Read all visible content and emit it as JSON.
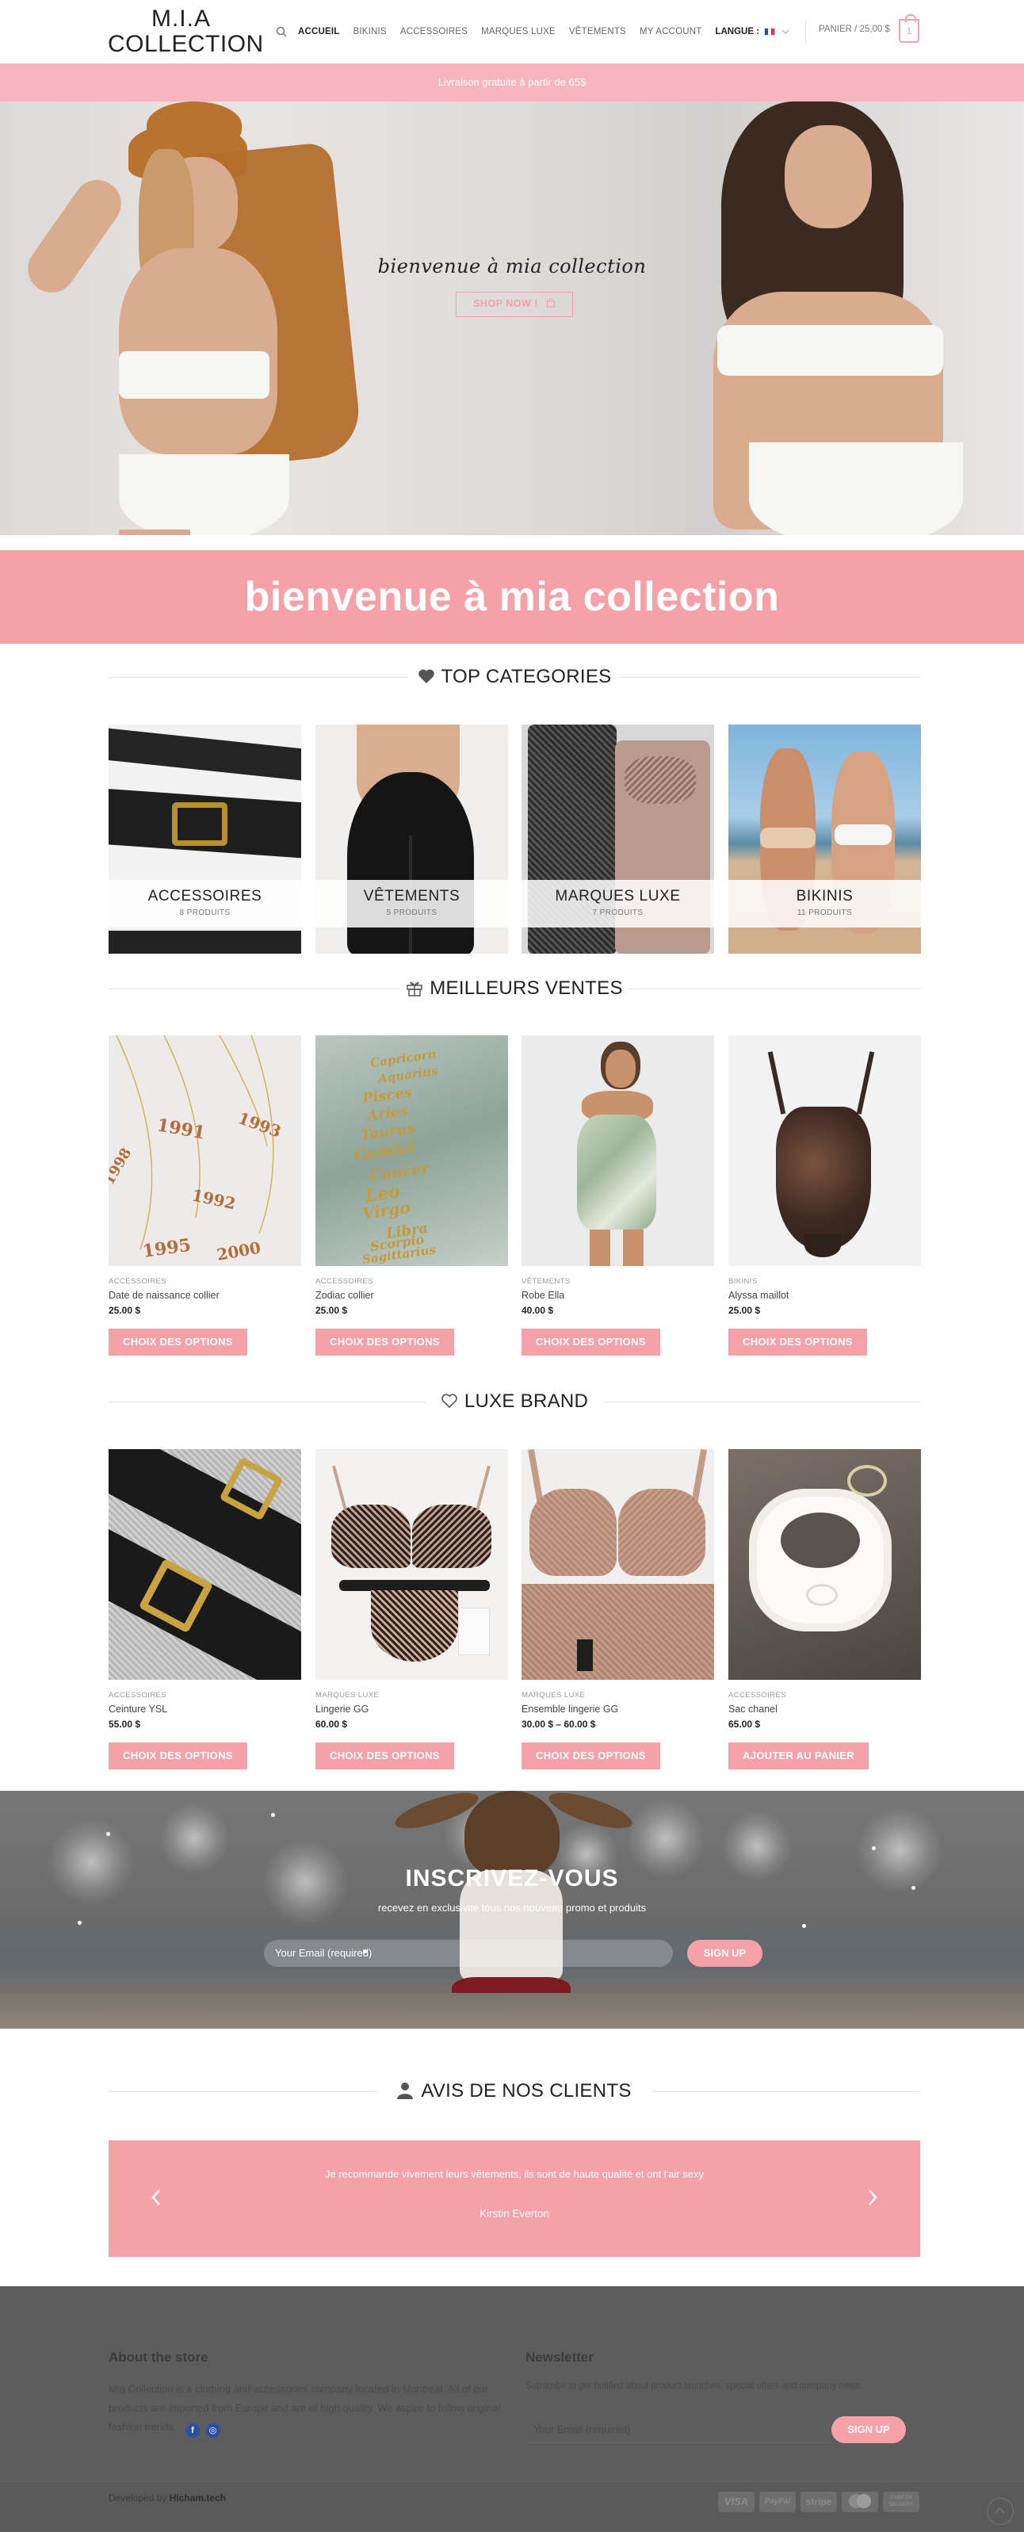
{
  "header": {
    "logo_line1": "M.I.A",
    "logo_line2": "COLLECTION",
    "nav": [
      "ACCUEIL",
      "BIKINIS",
      "ACCESSOIRES",
      "MARQUES LUXE",
      "VÊTEMENTS",
      "MY ACCOUNT"
    ],
    "language": "LANGUE :",
    "cart_label": "PANIER / 25,00 $",
    "cart_count": "1"
  },
  "shipping_bar": "Livraison gratuite à partir de 65$",
  "hero": {
    "title": "bienvenue à mia collection",
    "button": "SHOP NOW !"
  },
  "welcome_banner": "bienvenue à mia collection",
  "sections": {
    "categories_title": "TOP CATEGORIES",
    "best_title": "MEILLEURS VENTES",
    "luxe_title": "LUXE BRAND",
    "reviews_title": "AVIS DE NOS CLIENTS"
  },
  "categories": [
    {
      "name": "ACCESSOIRES",
      "count": "8 PRODUITS"
    },
    {
      "name": "VÊTEMENTS",
      "count": "5 PRODUITS"
    },
    {
      "name": "MARQUES LUXE",
      "count": "7 PRODUITS"
    },
    {
      "name": "BIKINIS",
      "count": "11 PRODUITS"
    }
  ],
  "best_sellers": [
    {
      "category": "ACCESSOIRES",
      "name": "Date de naissance collier",
      "price": "25.00 $",
      "button": "CHOIX DES OPTIONS"
    },
    {
      "category": "ACCESSOIRES",
      "name": "Zodiac collier",
      "price": "25.00 $",
      "button": "CHOIX DES OPTIONS"
    },
    {
      "category": "VÊTEMENTS",
      "name": "Robe Ella",
      "price": "40.00 $",
      "button": "CHOIX DES OPTIONS"
    },
    {
      "category": "BIKINIS",
      "name": "Alyssa maillot",
      "price": "25.00 $",
      "button": "CHOIX DES OPTIONS"
    }
  ],
  "luxe_products": [
    {
      "category": "ACCESSOIRES",
      "name": "Ceinture YSL",
      "price": "55.00 $",
      "button": "CHOIX DES OPTIONS"
    },
    {
      "category": "MARQUES LUXE",
      "name": "Lingerie GG",
      "price": "60.00 $",
      "button": "CHOIX DES OPTIONS"
    },
    {
      "category": "MARQUES LUXE",
      "name": "Ensemble lingerie GG",
      "price": "30.00 $ – 60.00 $",
      "button": "CHOIX DES OPTIONS"
    },
    {
      "category": "ACCESSOIRES",
      "name": "Sac chanel",
      "price": "65.00 $",
      "button": "AJOUTER AU PANIER"
    }
  ],
  "necklace_words": [
    "1991",
    "1993",
    "1992",
    "1995",
    "2000",
    "1998"
  ],
  "zodiac_words": [
    "Capricorn",
    "Aquarius",
    "Pisces",
    "Aries",
    "Taurus",
    "Gemini",
    "Cancer",
    "Leo",
    "Virgo",
    "Libra",
    "Scorpio",
    "Sagittarius"
  ],
  "newsletter": {
    "title": "INSCRIVEZ-VOUS",
    "subtitle": "recevez en exclusivité tous nos nouveau promo et produits",
    "email_placeholder": "Your Email (required)",
    "button": "SIGN UP"
  },
  "review": {
    "quote": "Je recommande vivement leurs vêtements, ils sont de haute qualité et ont l'air sexy",
    "author": "Kirstin Everton"
  },
  "footer": {
    "about_title": "About the store",
    "about_text": "Mia Collection is a clothing and accessories company located in Montreal. All of our products are imported from Europe and are of high quality. We aspire to follow original fashion trends.",
    "newsletter_title": "Newsletter",
    "newsletter_text": "Subscribe to get notified about product launches, special offers and company news.",
    "newsletter_placeholder": "Your Email (required)",
    "newsletter_button": "SIGN UP",
    "developed_by": "Developed by",
    "developer": "Hicham.tech",
    "payments": [
      "VISA",
      "PayPal",
      "stripe",
      "mastercard",
      "CASH ON DELIVERY"
    ]
  },
  "colors": {
    "accent": "#f4a1a8",
    "shipbar": "#f7b6bd",
    "footer_bg": "#5d5d5d"
  }
}
